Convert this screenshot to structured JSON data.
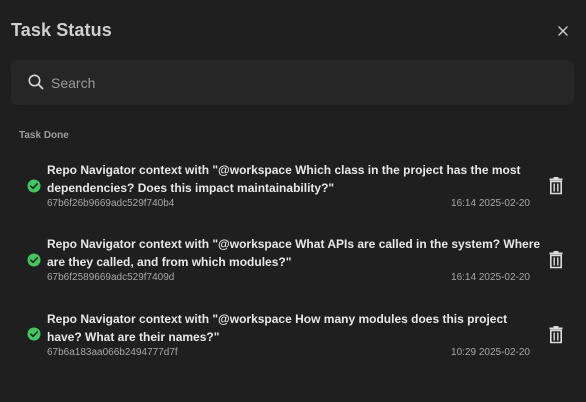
{
  "dialog": {
    "title": "Task Status",
    "close_icon": "close-icon"
  },
  "search": {
    "placeholder": "Search",
    "value": "",
    "icon": "search-icon"
  },
  "section": {
    "label": "Task Done"
  },
  "colors": {
    "background": "#1f1f1f",
    "search_background": "#262626",
    "success": "#3ec95f"
  },
  "tasks": [
    {
      "title": "Repo Navigator context with \"@workspace Which class in the project has the most dependencies? Does this impact maintainability?\"",
      "id": "67b6f26b9669adc529f740b4",
      "time": "16:14 2025-02-20",
      "status_icon": "check-circle-icon",
      "action_icon": "trash-icon"
    },
    {
      "title": "Repo Navigator context with \"@workspace What APIs are called in the system? Where are they called, and from which modules?\"",
      "id": "67b6f2589669adc529f7409d",
      "time": "16:14 2025-02-20",
      "status_icon": "check-circle-icon",
      "action_icon": "trash-icon"
    },
    {
      "title": "Repo Navigator context with \"@workspace How many modules does this project have? What are their names?\"",
      "id": "67b6a183aa066b2494777d7f",
      "time": "10:29 2025-02-20",
      "status_icon": "check-circle-icon",
      "action_icon": "trash-icon"
    }
  ]
}
